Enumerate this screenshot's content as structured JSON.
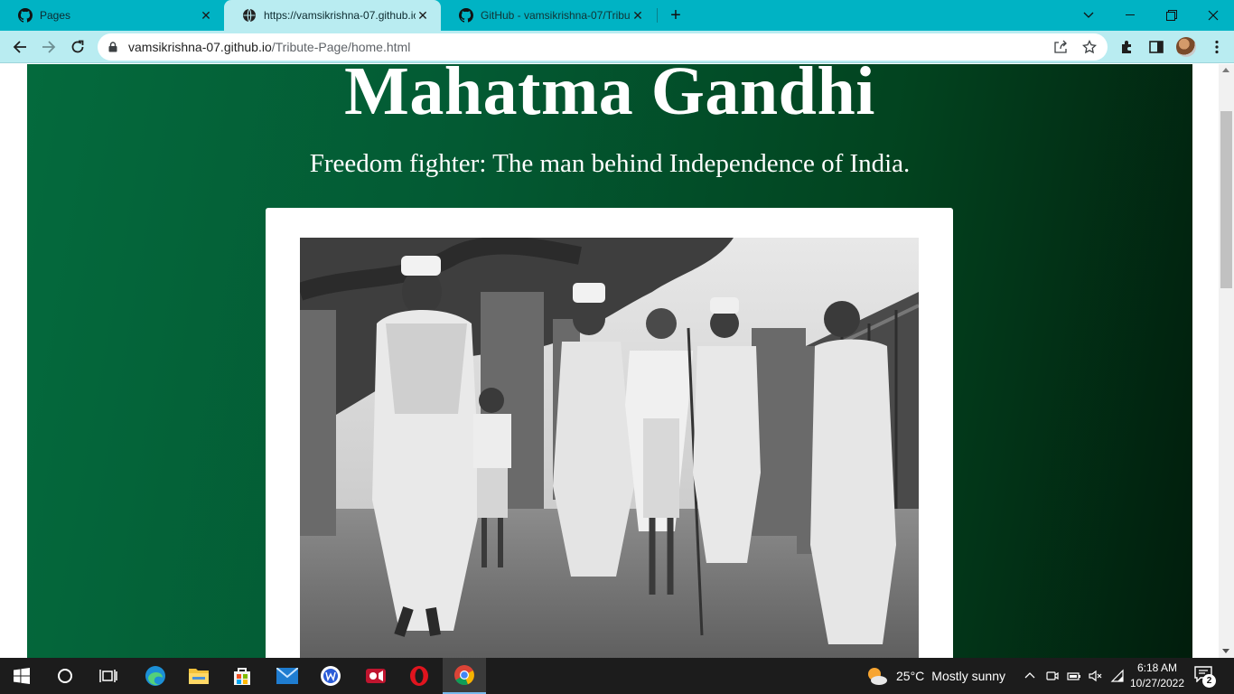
{
  "browser": {
    "tabs": [
      {
        "title": "Pages",
        "icon": "github-icon",
        "active": false
      },
      {
        "title": "https://vamsikrishna-07.github.io",
        "icon": "globe-icon",
        "active": true
      },
      {
        "title": "GitHub - vamsikrishna-07/Tribute",
        "icon": "github-icon",
        "active": false
      }
    ],
    "url": {
      "host": "vamsikrishna-07.github.io",
      "path": "/Tribute-Page/home.html"
    }
  },
  "page": {
    "heading": "Mahatma Gandhi",
    "subheading": "Freedom fighter: The man behind Independence of India.",
    "image_description": "Black and white photograph of Gandhi walking with a group of men"
  },
  "taskbar": {
    "weather": {
      "temperature": "25°C",
      "condition": "Mostly sunny"
    },
    "clock": {
      "time": "6:18 AM",
      "date": "10/27/2022"
    },
    "notification_count": "2",
    "apps": [
      "start-icon",
      "search-icon",
      "task-view-icon",
      "edge-icon",
      "file-explorer-icon",
      "store-icon",
      "mail-icon",
      "app-w-icon",
      "recorder-icon",
      "opera-icon",
      "chrome-icon"
    ]
  },
  "colors": {
    "tabstrip": "#00b3c4",
    "toolbar": "#b9ecf1",
    "page_green": "#035a33",
    "taskbar": "#1c1c1c"
  }
}
